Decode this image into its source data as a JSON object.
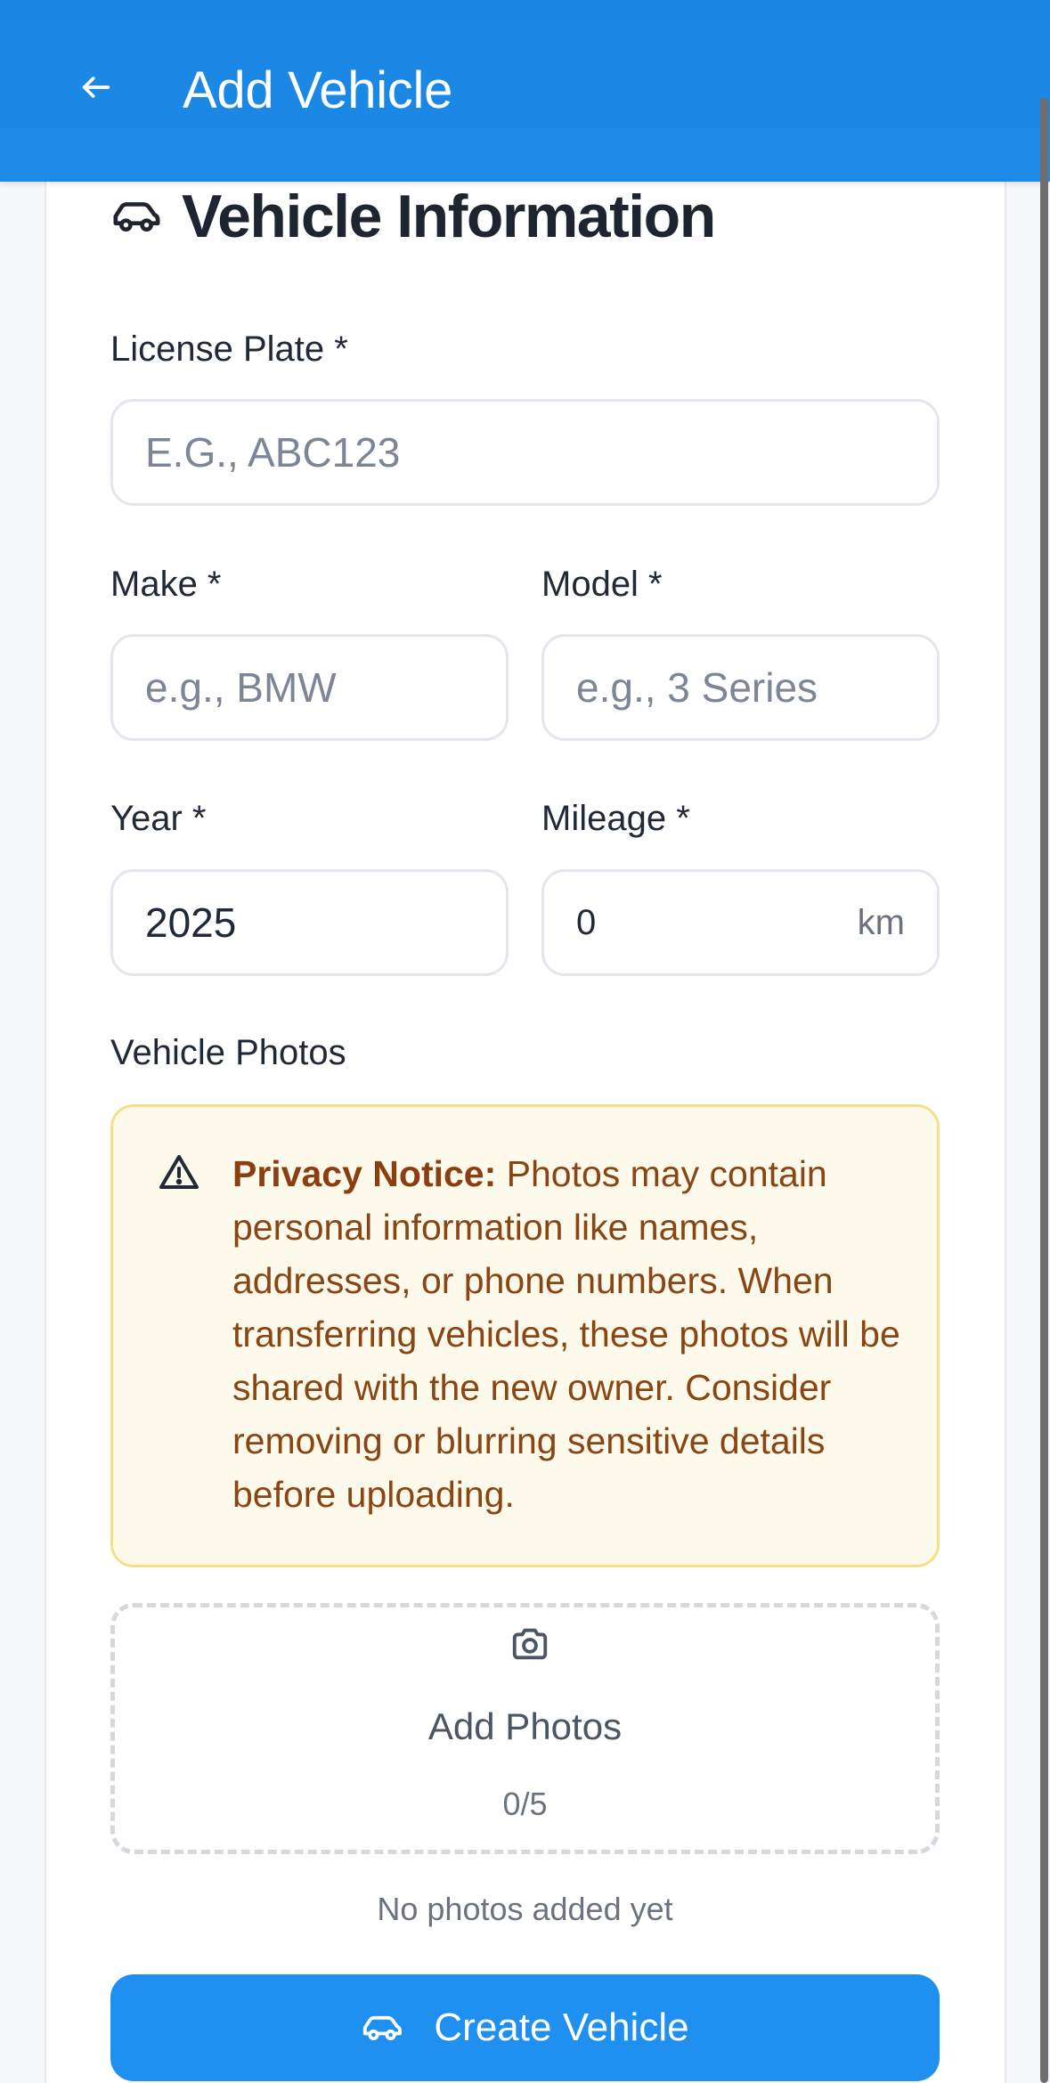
{
  "header": {
    "title": "Add Vehicle",
    "back_icon": "arrow-left-icon"
  },
  "section": {
    "title": "Vehicle Information",
    "icon": "car-icon"
  },
  "form": {
    "license_plate": {
      "label": "License Plate *",
      "placeholder": "E.G., ABC123",
      "value": ""
    },
    "make": {
      "label": "Make *",
      "placeholder": "e.g., BMW",
      "value": ""
    },
    "model": {
      "label": "Model *",
      "placeholder": "e.g., 3 Series",
      "value": ""
    },
    "year": {
      "label": "Year *",
      "value": "2025"
    },
    "mileage": {
      "label": "Mileage *",
      "value": "0",
      "unit": "km"
    }
  },
  "photos": {
    "label": "Vehicle Photos",
    "notice": {
      "icon": "warning-triangle-icon",
      "title": "Privacy Notice:",
      "body": " Photos may contain personal information like names, addresses, or phone numbers. When transferring vehicles, these photos will be shared with the new owner. Consider removing or blurring sensitive details before uploading."
    },
    "dropzone": {
      "icon": "camera-icon",
      "label": "Add Photos",
      "count": "0/5"
    },
    "empty_text": "No photos added yet"
  },
  "actions": {
    "create_label": "Create Vehicle",
    "create_icon": "car-icon"
  },
  "colors": {
    "primary": "#1f8ff0",
    "header": "#1a86e4",
    "notice_bg": "#fdfaeb",
    "notice_border": "#f3e08a",
    "notice_text": "#8a4514"
  }
}
